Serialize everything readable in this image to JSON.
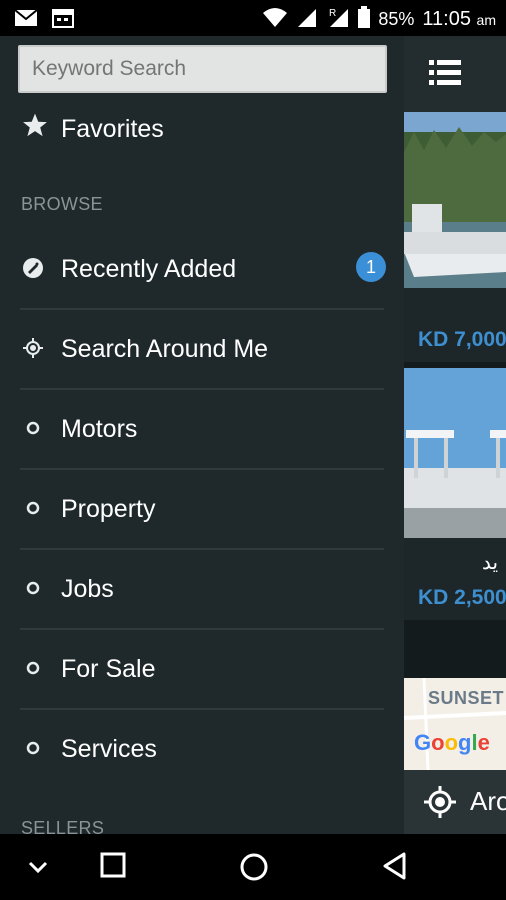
{
  "status_bar": {
    "battery": "85%",
    "time": "11:05",
    "ampm": "am",
    "icons": [
      "gmail-icon",
      "calendar-icon",
      "wifi-icon",
      "signal-icon",
      "roaming-signal-icon",
      "battery-icon"
    ]
  },
  "drawer": {
    "search": {
      "placeholder": "Keyword Search",
      "value": ""
    },
    "favorites": {
      "label": "Favorites",
      "icon": "star-icon"
    },
    "browse_header": "BROWSE",
    "items": [
      {
        "label": "Recently Added",
        "icon": "tag-icon",
        "badge": "1"
      },
      {
        "label": "Search Around Me",
        "icon": "location-target-icon"
      },
      {
        "label": "Motors",
        "icon": "circle-icon"
      },
      {
        "label": "Property",
        "icon": "circle-icon"
      },
      {
        "label": "Jobs",
        "icon": "circle-icon"
      },
      {
        "label": "For Sale",
        "icon": "circle-icon"
      },
      {
        "label": "Services",
        "icon": "circle-icon"
      }
    ],
    "sellers_header": "SELLERS"
  },
  "background": {
    "listings": [
      {
        "price": "KD 7,000"
      },
      {
        "arabic_text": "يد",
        "price": "KD 2,500"
      }
    ],
    "map": {
      "place_label": "SUNSET",
      "provider": "Google"
    },
    "around_label": "Arou"
  },
  "colors": {
    "drawer_bg": "#1f292b",
    "accent_blue": "#3a8fd6",
    "price_blue": "#3e8fd0"
  }
}
